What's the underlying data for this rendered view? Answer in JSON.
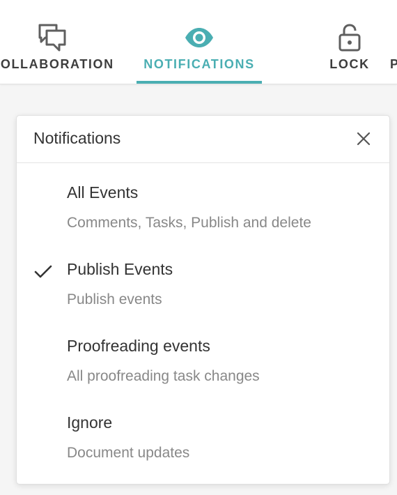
{
  "toolbar": {
    "tabs": [
      {
        "label": "COLLABORATION",
        "icon": "chat-bubbles-icon",
        "active": false
      },
      {
        "label": "NOTIFICATIONS",
        "icon": "eye-icon",
        "active": true
      },
      {
        "label": "LOCK",
        "icon": "lock-icon",
        "active": false
      },
      {
        "label": "P",
        "icon": "",
        "active": false
      }
    ],
    "accent_color": "#4aaeb2"
  },
  "panel": {
    "title": "Notifications",
    "close_icon": "close-icon",
    "options": [
      {
        "title": "All Events",
        "description": "Comments, Tasks, Publish and delete",
        "checked": false
      },
      {
        "title": "Publish Events",
        "description": "Publish events",
        "checked": true
      },
      {
        "title": "Proofreading events",
        "description": "All proofreading task changes",
        "checked": false
      },
      {
        "title": "Ignore",
        "description": "Document updates",
        "checked": false
      }
    ]
  }
}
